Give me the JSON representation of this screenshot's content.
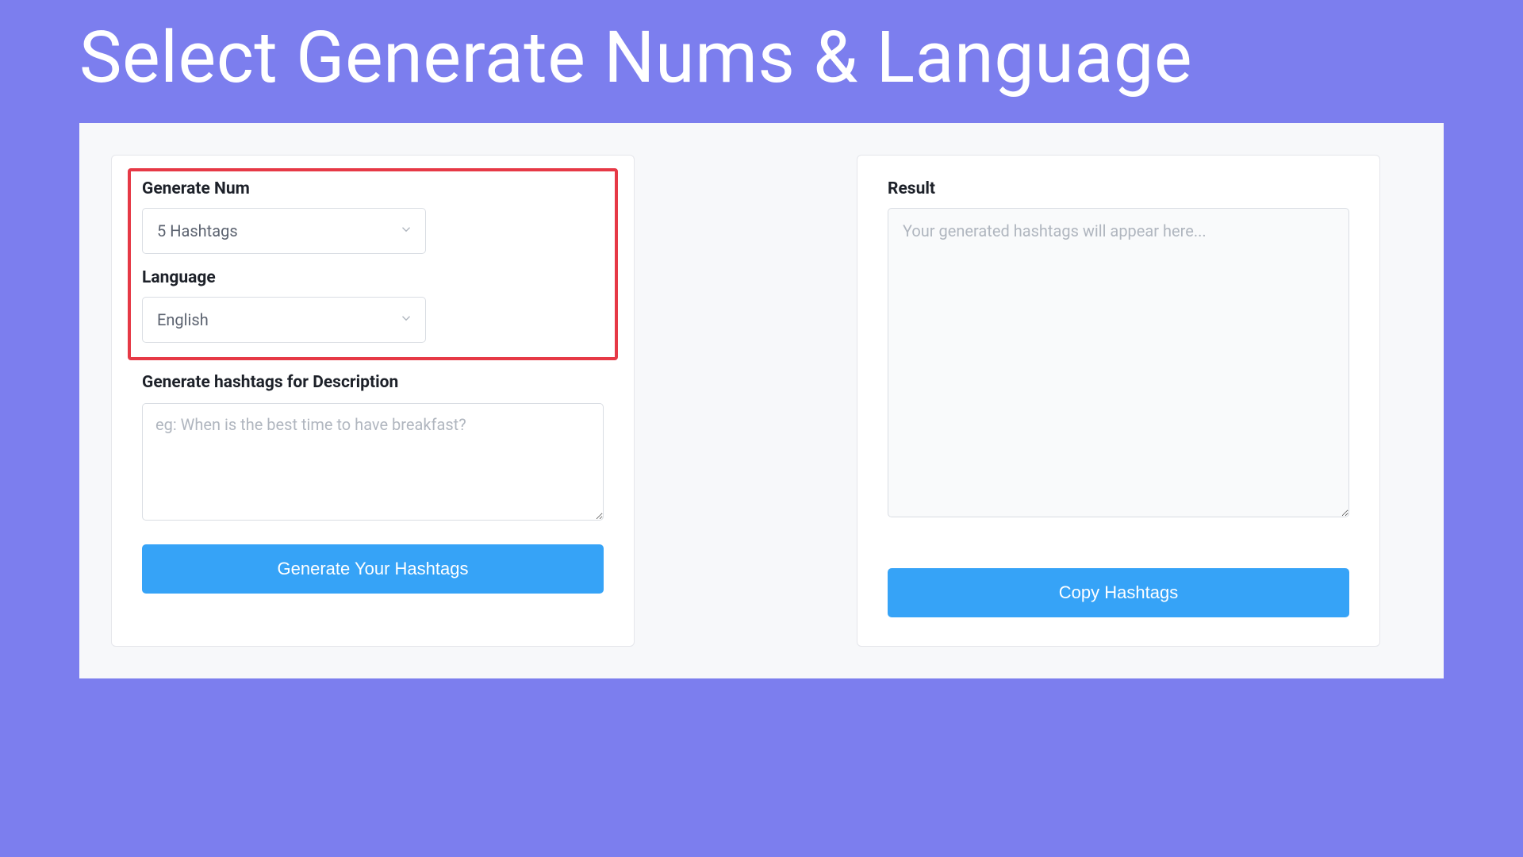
{
  "title": "Select Generate Nums & Language",
  "form": {
    "generate_num": {
      "label": "Generate Num",
      "value": "5 Hashtags"
    },
    "language": {
      "label": "Language",
      "value": "English"
    },
    "description": {
      "label": "Generate hashtags for Description",
      "placeholder": "eg: When is the best time to have breakfast?"
    },
    "generate_button": "Generate Your Hashtags"
  },
  "result": {
    "label": "Result",
    "placeholder": "Your generated hashtags will appear here...",
    "copy_button": "Copy Hashtags"
  }
}
